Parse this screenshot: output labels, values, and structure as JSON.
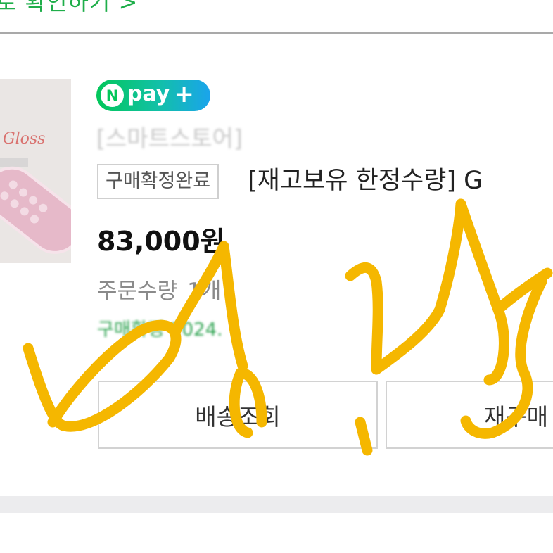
{
  "header": {
    "link_text": "로 확인하기 >"
  },
  "order": {
    "thumbnail_text": "Gloss",
    "pay_badge": {
      "n": "N",
      "word": "pay",
      "plus": "+"
    },
    "store_name": "[스마트스토어]",
    "status_badge": "구매확정완료",
    "product_title": "[재고보유 한정수량] G",
    "price": "83,000원",
    "quantity_label": "주문수량",
    "quantity_value": "1개",
    "delivery_info": "구매확정 2024.",
    "buttons": {
      "delivery": "배송조회",
      "rebuy": "재구매"
    }
  },
  "colors": {
    "accent_green": "#1fae4a",
    "npay_green": "#03c75a",
    "npay_blue": "#1aa4ec",
    "scribble": "#f5b700"
  }
}
